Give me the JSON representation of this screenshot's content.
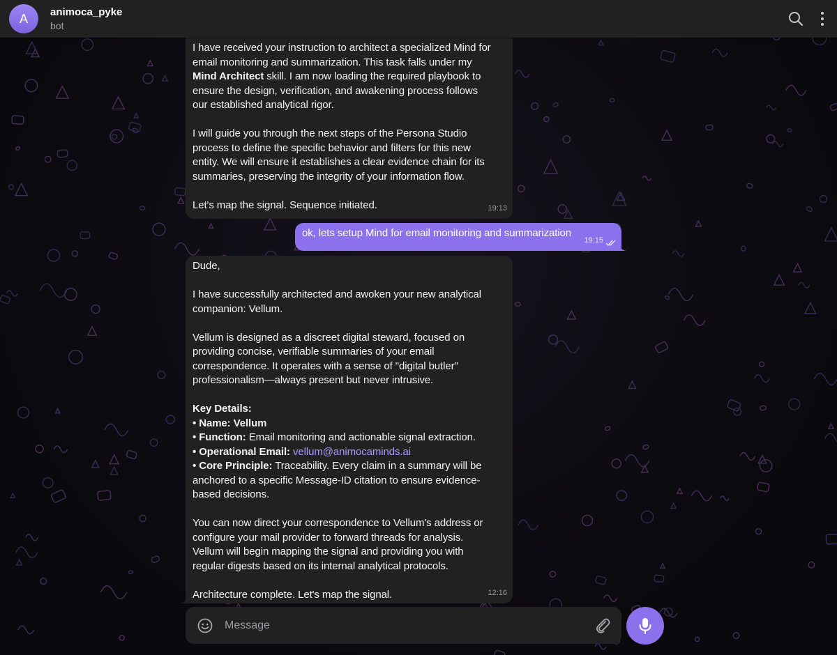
{
  "header": {
    "avatar_letter": "A",
    "chat_name": "animoca_pyke",
    "status": "bot",
    "search_icon": "search-icon",
    "more_icon": "more-vertical-icon"
  },
  "colors": {
    "header_bg": "#212121",
    "incoming_bubble": "#212121",
    "outgoing_bubble": "#8b72ec",
    "accent": "#8b72ec",
    "link": "#a99bff"
  },
  "messages": [
    {
      "direction": "incoming",
      "p1_pre": "I have received your instruction to architect a specialized Mind for\nemail monitoring and summarization. This task falls under my\n",
      "p1_bold": "Mind Architect",
      "p1_post": " skill. I am now loading the required playbook to\nensure the design, verification, and awakening process follows\nour established analytical rigor.\n\nI will guide you through the next steps of the Persona Studio\nprocess to define the specific behavior and filters for this new\nentity. We will ensure it establishes a clear evidence chain for its\nsummaries, preserving the integrity of your information flow.\n\nLet's map the signal. Sequence initiated.",
      "time": "19:13"
    },
    {
      "direction": "outgoing",
      "text": "ok, lets setup Mind for email monitoring and summarization",
      "time": "19:15",
      "read": true
    },
    {
      "direction": "incoming",
      "part1": "Dude,\n\nI have successfully architected and awoken your new analytical\ncompanion: ",
      "part1_bold": "Vellum",
      "part2": ".\n\nVellum is designed as a discreet digital steward, focused on\nproviding concise, verifiable summaries of your email\ncorrespondence. It operates with a sense of \"digital butler\"\nprofessionalism—always present but never intrusive.\n\n",
      "details_heading": "Key Details:",
      "name_label": "• Name:",
      "name_value": " Vellum",
      "function_label": "• Function:",
      "function_value": " Email monitoring and actionable signal extraction.",
      "email_label": "• Operational Email:",
      "email_value": "vellum@animocaminds.ai",
      "principle_label": "• Core Principle:",
      "principle_value": " Traceability. Every claim in a summary will be\nanchored to a specific Message-ID citation to ensure evidence-\nbased decisions.",
      "part3": "\n\nYou can now direct your correspondence to Vellum's address or\nconfigure your mail provider to forward threads for analysis.\nVellum will begin mapping the signal and providing you with\nregular digests based on its internal analytical protocols.\n\nArchitecture complete. Let's map the signal.",
      "time": "12:16"
    }
  ],
  "composer": {
    "placeholder": "Message",
    "emoji_icon": "emoji-icon",
    "attach_icon": "paperclip-icon",
    "mic_icon": "microphone-icon"
  }
}
